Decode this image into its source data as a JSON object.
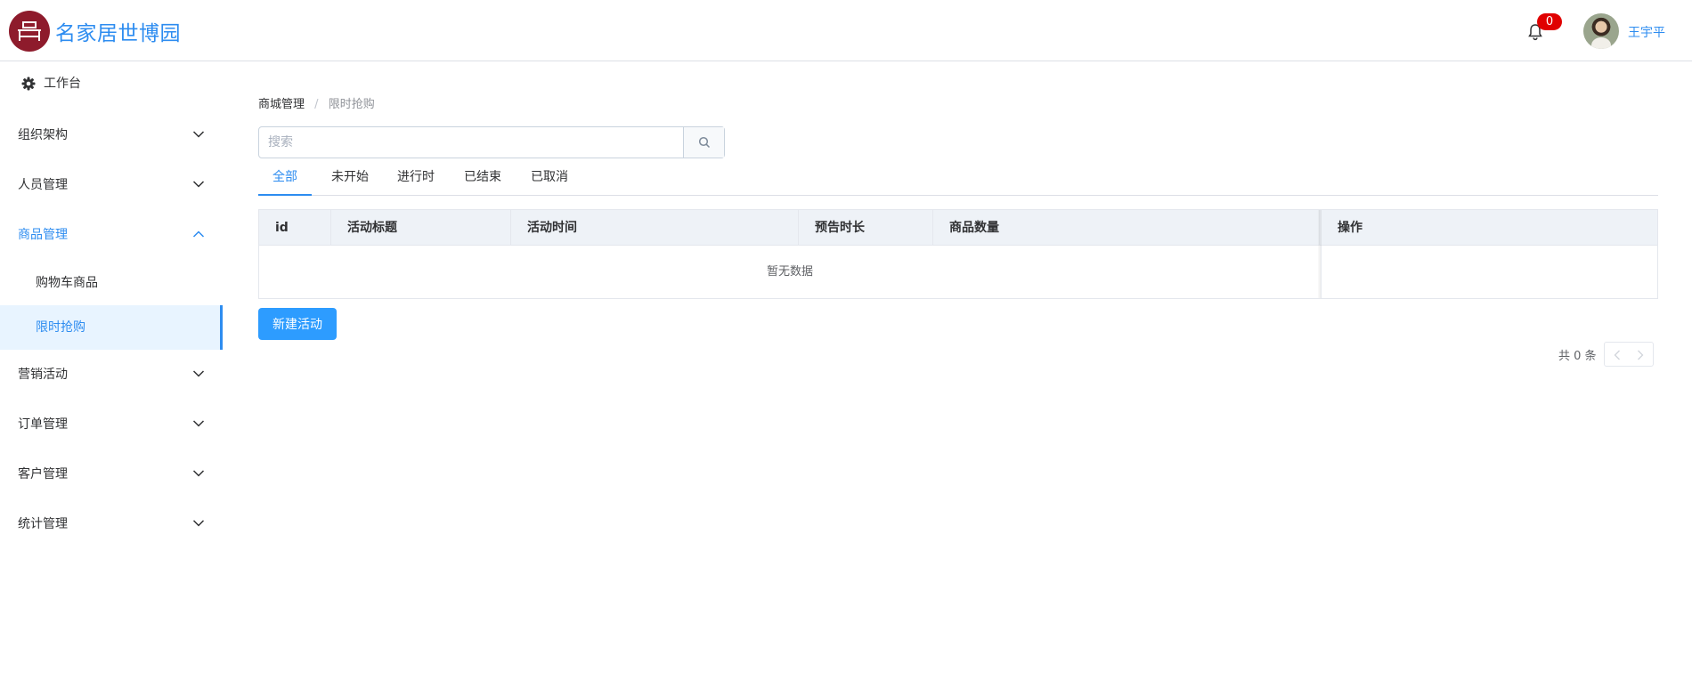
{
  "header": {
    "brand": "名家居世博园",
    "notification_count": "0",
    "username": "王宇平"
  },
  "sidebar": {
    "home": "工作台",
    "items": [
      {
        "label": "组织架构"
      },
      {
        "label": "人员管理"
      },
      {
        "label": "商品管理",
        "open": true,
        "children": [
          {
            "label": "购物车商品"
          },
          {
            "label": "限时抢购",
            "active": true
          }
        ]
      },
      {
        "label": "营销活动"
      },
      {
        "label": "订单管理"
      },
      {
        "label": "客户管理"
      },
      {
        "label": "统计管理"
      }
    ]
  },
  "breadcrumb": {
    "parent": "商城管理",
    "separator": "/",
    "current": "限时抢购"
  },
  "search": {
    "placeholder": "搜索",
    "value": ""
  },
  "tabs": [
    "全部",
    "未开始",
    "进行时",
    "已结束",
    "已取消"
  ],
  "table": {
    "columns": [
      "id",
      "活动标题",
      "活动时间",
      "预告时长",
      "商品数量",
      "操作"
    ],
    "rows": [],
    "empty_text": "暂无数据"
  },
  "actions": {
    "new_activity": "新建活动"
  },
  "pagination": {
    "total_text": "共 0 条"
  },
  "colors": {
    "accent": "#2d8cf0",
    "logo": "#8e1b2c",
    "badge": "#e00000",
    "button": "#2d9cff"
  }
}
